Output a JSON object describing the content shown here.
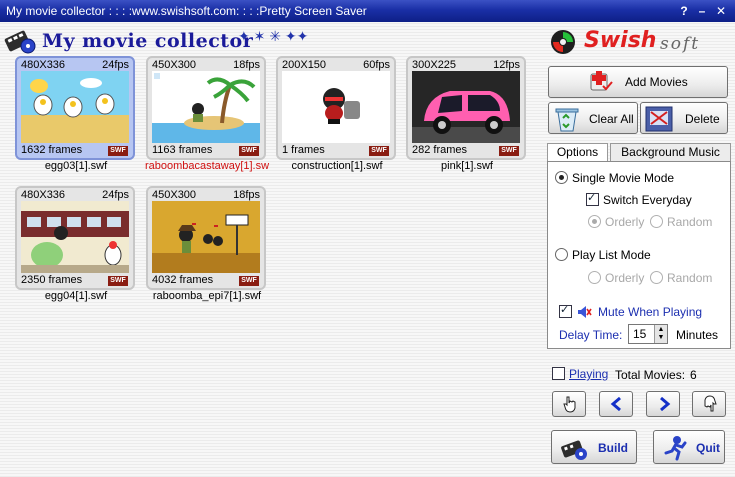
{
  "window": {
    "title": "My movie collector : : : :www.swishsoft.com: : : :Pretty Screen Saver",
    "help": "?",
    "minimize": "–",
    "close": "✕"
  },
  "header": {
    "app_title": "My movie collector",
    "stars": "✦ ✶ ✳ ✦✦",
    "brand_word1": "Swish",
    "brand_word2": "soft"
  },
  "movies": [
    {
      "dims": "480X336",
      "fps": "24fps",
      "frames": "1632 frames",
      "badge": "SWF",
      "name": "egg03[1].swf",
      "selected": true
    },
    {
      "dims": "450X300",
      "fps": "18fps",
      "frames": "1163 frames",
      "badge": "SWF",
      "name": "raboombacastaway[1].sw",
      "error": true
    },
    {
      "dims": "200X150",
      "fps": "60fps",
      "frames": "1 frames",
      "badge": "SWF",
      "name": "construction[1].swf"
    },
    {
      "dims": "300X225",
      "fps": "12fps",
      "frames": "282 frames",
      "badge": "SWF",
      "name": "pink[1].swf"
    },
    {
      "dims": "480X336",
      "fps": "24fps",
      "frames": "2350 frames",
      "badge": "SWF",
      "name": "egg04[1].swf"
    },
    {
      "dims": "450X300",
      "fps": "18fps",
      "frames": "4032 frames",
      "badge": "SWF",
      "name": "raboomba_epi7[1].swf"
    }
  ],
  "buttons": {
    "add_movies": "Add Movies",
    "clear_all": "Clear All",
    "delete": "Delete",
    "build": "Build",
    "quit": "Quit"
  },
  "tabs": {
    "options": "Options",
    "background_music": "Background Music"
  },
  "options": {
    "single_mode": "Single Movie Mode",
    "switch_everyday": "Switch Everyday",
    "orderly": "Orderly",
    "random": "Random",
    "playlist_mode": "Play List Mode",
    "mute": "Mute When Playing",
    "delay_label": "Delay Time:",
    "delay_value": "15",
    "minutes": "Minutes"
  },
  "status": {
    "playing": "Playing",
    "total_label": "Total Movies:",
    "total_value": "6"
  },
  "colors": {
    "titlebar": "#1a2fa6",
    "accent_blue": "#1c2fb0",
    "error_red": "#d01010",
    "swf_badge": "#8a1d12"
  }
}
